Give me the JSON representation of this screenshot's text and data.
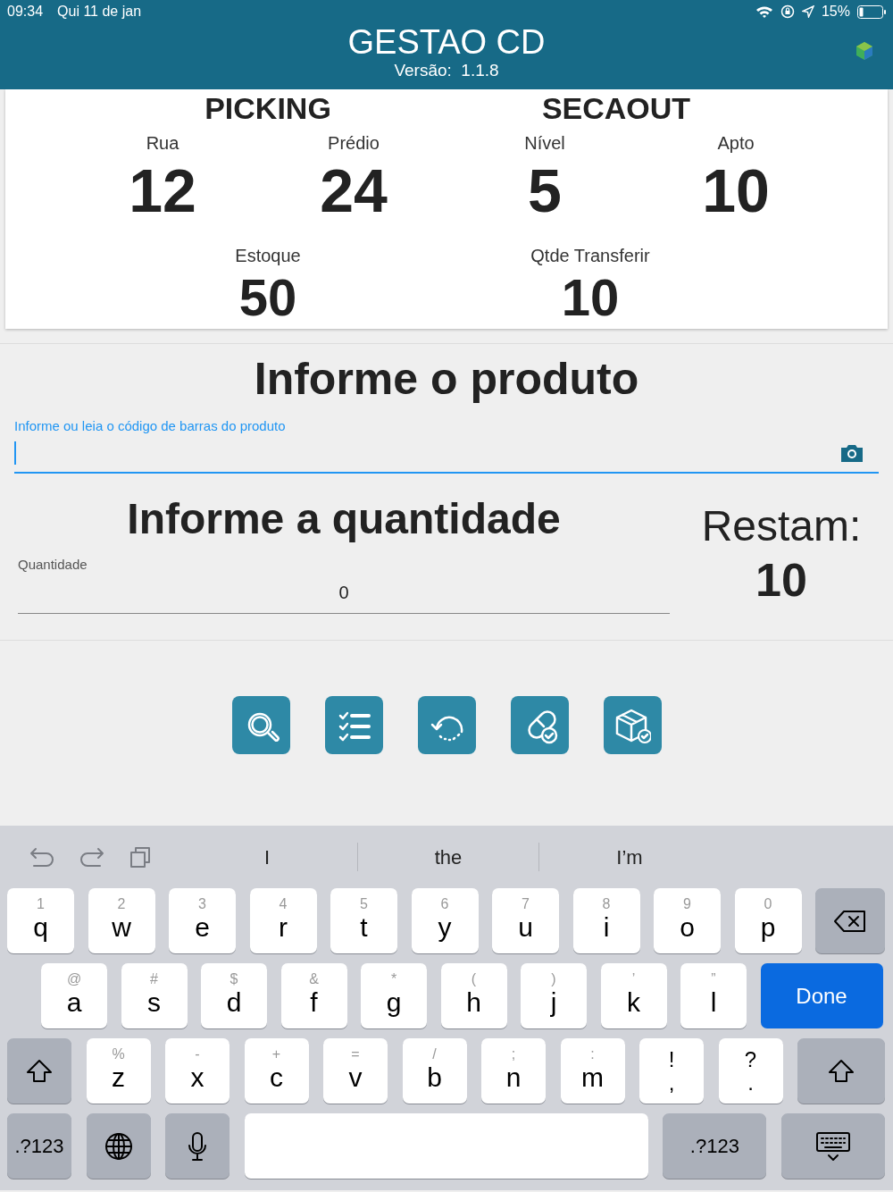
{
  "status_bar": {
    "time": "09:34",
    "date": "Qui 11 de jan",
    "battery": "15%"
  },
  "header": {
    "title": "GESTAO CD",
    "version": "Versão:  1.1.8"
  },
  "card": {
    "sections": [
      "PICKING",
      "SECAOUT"
    ],
    "location": [
      {
        "label": "Rua",
        "value": "12"
      },
      {
        "label": "Prédio",
        "value": "24"
      },
      {
        "label": "Nível",
        "value": "5"
      },
      {
        "label": "Apto",
        "value": "10"
      }
    ],
    "stock": [
      {
        "label": "Estoque",
        "value": "50"
      },
      {
        "label": "Qtde Transferir",
        "value": "10"
      }
    ]
  },
  "product": {
    "heading": "Informe o produto",
    "field_label": "Informe ou leia o código de barras do produto",
    "focused": true
  },
  "quantity": {
    "heading": "Informe a quantidade",
    "field_label": "Quantidade",
    "value": "0",
    "focused": false,
    "remaining_label": "Restam:",
    "remaining": "10"
  },
  "keyboard": {
    "suggestions": [
      "I",
      "the",
      "I’m"
    ],
    "rows": [
      [
        {
          "kind": "letter",
          "main": "q",
          "alt": "1"
        },
        {
          "kind": "letter",
          "main": "w",
          "alt": "2"
        },
        {
          "kind": "letter",
          "main": "e",
          "alt": "3"
        },
        {
          "kind": "letter",
          "main": "r",
          "alt": "4"
        },
        {
          "kind": "letter",
          "main": "t",
          "alt": "5"
        },
        {
          "kind": "letter",
          "main": "y",
          "alt": "6"
        },
        {
          "kind": "letter",
          "main": "u",
          "alt": "7"
        },
        {
          "kind": "letter",
          "main": "i",
          "alt": "8"
        },
        {
          "kind": "letter",
          "main": "o",
          "alt": "9"
        },
        {
          "kind": "letter",
          "main": "p",
          "alt": "0"
        },
        {
          "kind": "backspace"
        }
      ],
      [
        {
          "kind": "letter",
          "main": "a",
          "alt": "@"
        },
        {
          "kind": "letter",
          "main": "s",
          "alt": "#"
        },
        {
          "kind": "letter",
          "main": "d",
          "alt": "$"
        },
        {
          "kind": "letter",
          "main": "f",
          "alt": "&"
        },
        {
          "kind": "letter",
          "main": "g",
          "alt": "*"
        },
        {
          "kind": "letter",
          "main": "h",
          "alt": "("
        },
        {
          "kind": "letter",
          "main": "j",
          "alt": ")"
        },
        {
          "kind": "letter",
          "main": "k",
          "alt": "’"
        },
        {
          "kind": "letter",
          "main": "l",
          "alt": "”"
        },
        {
          "kind": "done",
          "label": "Done"
        }
      ],
      [
        {
          "kind": "shift"
        },
        {
          "kind": "letter",
          "main": "z",
          "alt": "%"
        },
        {
          "kind": "letter",
          "main": "x",
          "alt": "-"
        },
        {
          "kind": "letter",
          "main": "c",
          "alt": "+"
        },
        {
          "kind": "letter",
          "main": "v",
          "alt": "="
        },
        {
          "kind": "letter",
          "main": "b",
          "alt": "/"
        },
        {
          "kind": "letter",
          "main": "n",
          "alt": ";"
        },
        {
          "kind": "letter",
          "main": "m",
          "alt": ":"
        },
        {
          "kind": "punct",
          "main": ",",
          "alt": "!"
        },
        {
          "kind": "punct",
          "main": ".",
          "alt": "?"
        },
        {
          "kind": "shift"
        }
      ],
      [
        {
          "kind": "mode",
          "label": ".?123"
        },
        {
          "kind": "globe"
        },
        {
          "kind": "mic"
        },
        {
          "kind": "space"
        },
        {
          "kind": "mode",
          "label": ".?123"
        },
        {
          "kind": "hide"
        }
      ]
    ]
  }
}
